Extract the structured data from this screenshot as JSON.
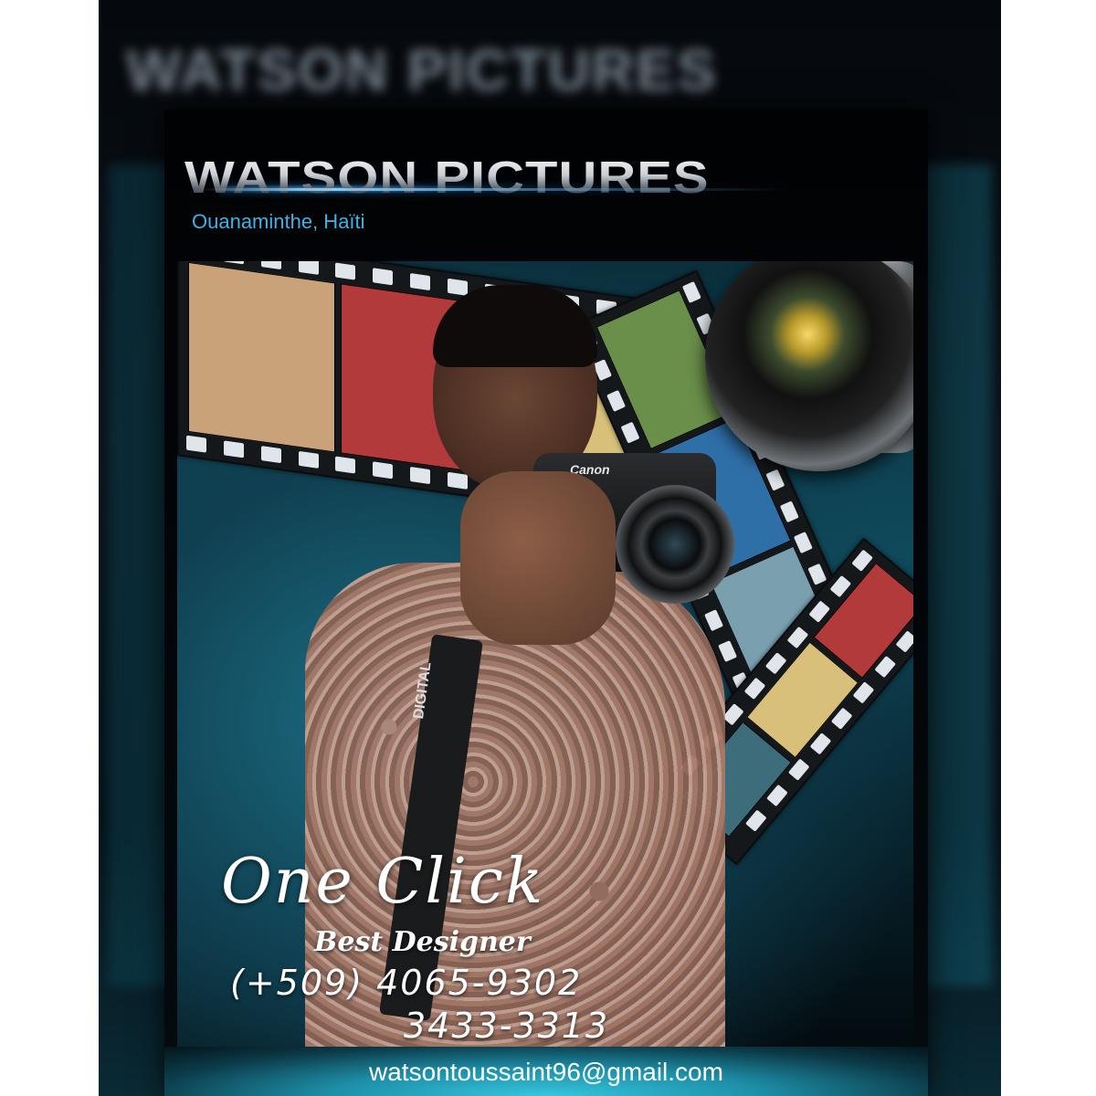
{
  "poster": {
    "title": "WATSON PICTURES",
    "location": "Ouanaminthe, Haïti",
    "tagline": "One Click",
    "subtitle": "Best Designer",
    "phone_primary": "(+509) 4065-9302",
    "phone_secondary": "3433-3313",
    "email": "watsontoussaint96@gmail.com",
    "camera_brand": "Canon",
    "strap_text": "DIGITAL"
  },
  "colors": {
    "accent": "#3fb3e6",
    "background": "#040a0e",
    "text": "#ffffff"
  }
}
